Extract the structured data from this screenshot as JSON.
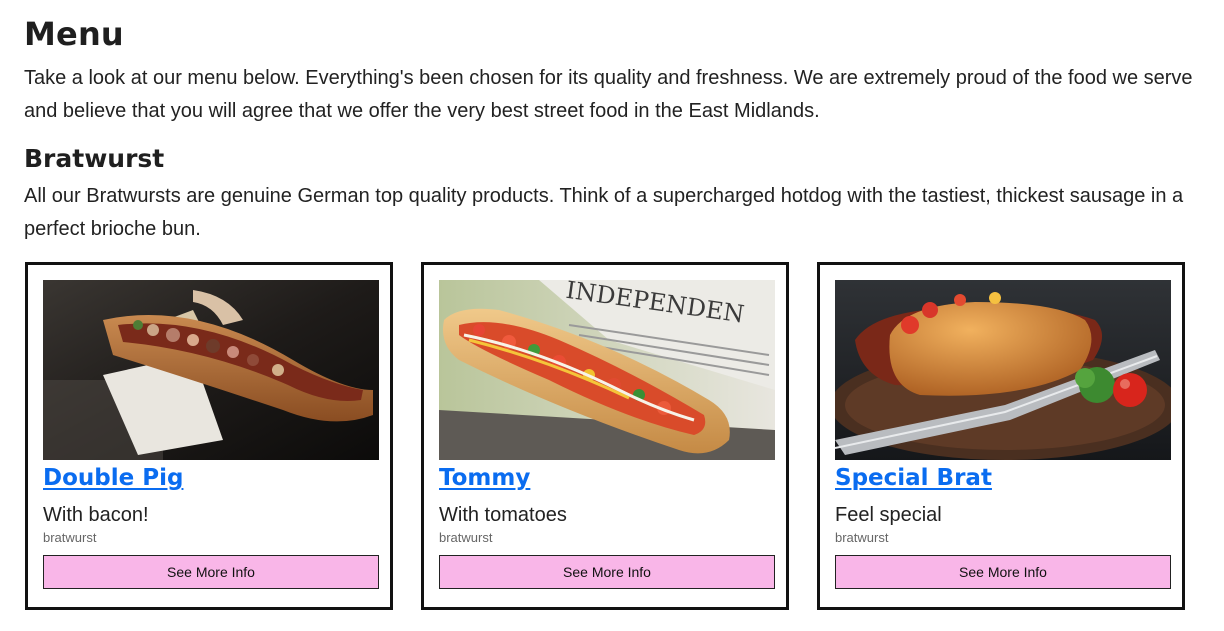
{
  "page": {
    "title": "Menu",
    "intro": "Take a look at our menu below. Everything's been chosen for its quality and freshness. We are extremely proud of the food we serve and believe that you will agree that we offer the very best street food in the East Midlands."
  },
  "section": {
    "title": "Bratwurst",
    "description": "All our Bratwursts are genuine German top quality products. Think of a supercharged hotdog with the tastiest, thickest sausage in a perfect brioche bun."
  },
  "colors": {
    "link": "#0a6cf0",
    "button_bg": "#f9b6e8",
    "card_border": "#111111"
  },
  "cards": [
    {
      "title": "Double Pig",
      "description": "With bacon!",
      "category": "bratwurst",
      "button_label": "See More Info",
      "image": "hotdog-with-bacon-photo"
    },
    {
      "title": "Tommy",
      "description": "With tomatoes",
      "category": "bratwurst",
      "button_label": "See More Info",
      "image": "hotdog-with-tomatoes-photo"
    },
    {
      "title": "Special Brat",
      "description": "Feel special",
      "category": "bratwurst",
      "button_label": "See More Info",
      "image": "bratwurst-with-fork-photo"
    }
  ]
}
